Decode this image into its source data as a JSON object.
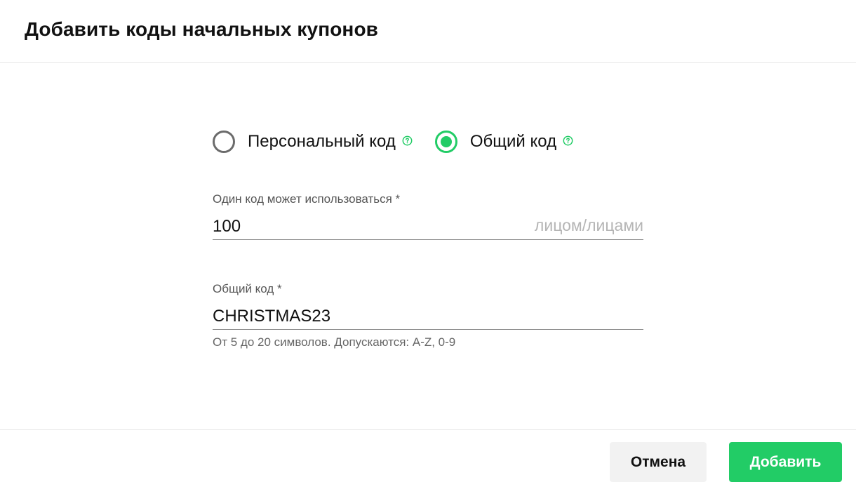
{
  "dialog": {
    "title": "Добавить коды начальных купонов"
  },
  "code_type": {
    "options": [
      {
        "label": "Персональный код",
        "checked": false,
        "help_icon": "help-circle-icon"
      },
      {
        "label": "Общий код",
        "checked": true,
        "help_icon": "help-circle-icon"
      }
    ]
  },
  "usage_field": {
    "label": "Один код может использоваться *",
    "value": "100",
    "suffix": "лицом/лицами"
  },
  "common_code_field": {
    "label": "Общий код *",
    "value": "CHRISTMAS23",
    "hint": "От 5 до 20 символов. Допускаются: A-Z, 0-9"
  },
  "footer": {
    "cancel_label": "Отмена",
    "add_label": "Добавить"
  },
  "colors": {
    "accent": "#22cc66",
    "radio_unchecked": "#6b6b6b",
    "cancel_bg": "#f2f2f2"
  }
}
